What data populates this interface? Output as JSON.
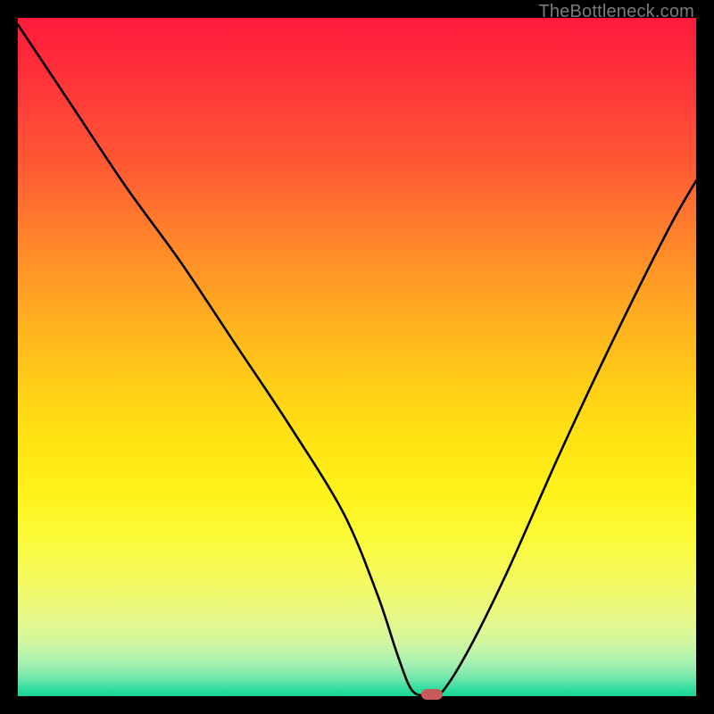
{
  "watermark": "TheBottleneck.com",
  "chart_data": {
    "type": "line",
    "title": "",
    "xlabel": "",
    "ylabel": "",
    "xlim": [
      0,
      100
    ],
    "ylim": [
      0,
      100
    ],
    "grid": false,
    "legend": false,
    "background_gradient": [
      "#ff1a3c",
      "#ffce17",
      "#fff21a",
      "#18d697"
    ],
    "series": [
      {
        "name": "bottleneck-curve",
        "x": [
          0,
          8,
          16,
          24,
          32,
          40,
          48,
          53,
          56,
          58,
          60,
          62,
          66,
          72,
          80,
          88,
          96,
          100
        ],
        "values": [
          99,
          87,
          75,
          64,
          52,
          40,
          27,
          15,
          6,
          1,
          0,
          0,
          6,
          18,
          36,
          53,
          69,
          76
        ]
      }
    ],
    "marker": {
      "x": 61,
      "y": 0,
      "color": "#c85a5a"
    }
  }
}
